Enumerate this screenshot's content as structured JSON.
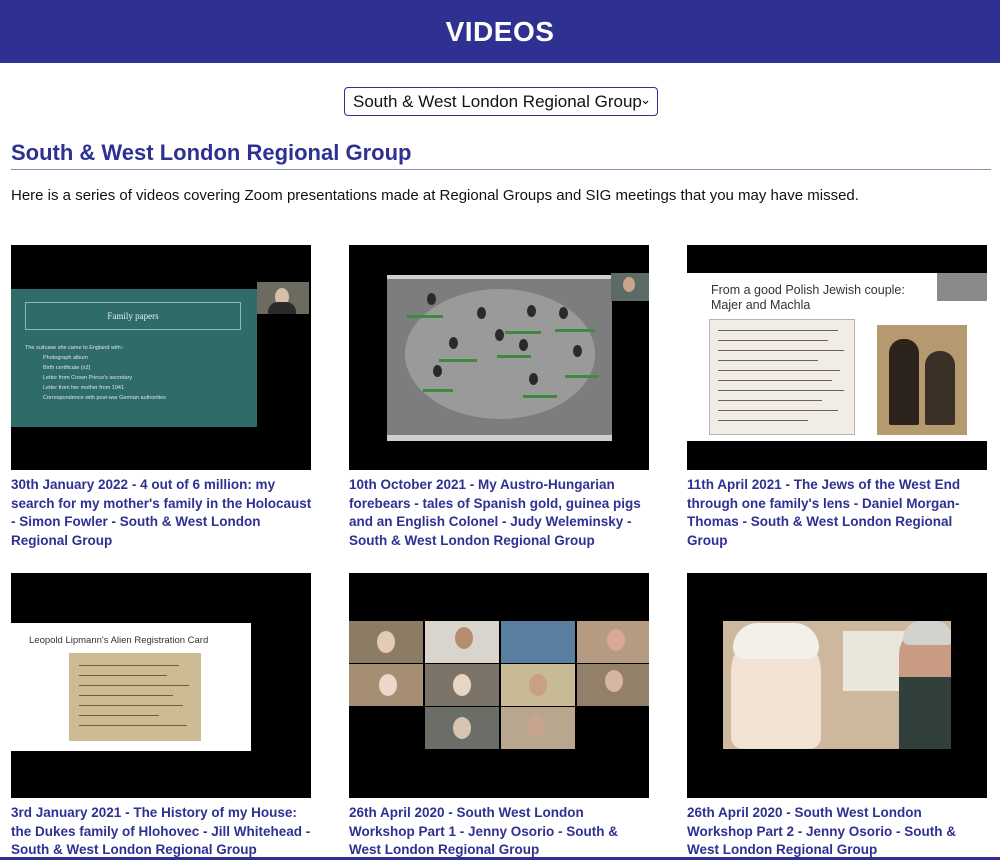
{
  "header": {
    "title": "VIDEOS"
  },
  "group_select": {
    "selected": "South & West London Regional Group"
  },
  "section": {
    "title": "South & West London Regional Group",
    "intro": "Here is a series of videos covering Zoom presentations made at Regional Groups and SIG meetings that you may have missed."
  },
  "videos": [
    {
      "caption": "30th January 2022 - 4 out of 6 million: my search for my mother's family in the Holocaust - Simon Fowler - South & West London Regional Group",
      "slide_title": "Family papers",
      "slide_lines": [
        "The suitcase she came to England with:-",
        "Photograph album",
        "Birth certificate (x2)",
        "Letter from Crown Prince's secretary",
        "Letter from her mother from 1941",
        "Correspondence with post-war German authorities"
      ]
    },
    {
      "caption": "10th October 2021 - My Austro-Hungarian forebears - tales of Spanish gold, guinea pigs and an English Colonel - Judy Weleminsky - South & West London Regional Group"
    },
    {
      "caption": "11th April 2021 - The Jews of the West End through one family's lens - Daniel Morgan-Thomas - South & West London Regional Group",
      "slide_title_line1": "From a good Polish Jewish couple:",
      "slide_title_line2": "Majer and Machla"
    },
    {
      "caption": "3rd January 2021 - The History of my House: the Dukes family of Hlohovec - Jill Whitehead - South & West London Regional Group",
      "slide_title": "Leopold Lipmann's Alien Registration Card"
    },
    {
      "caption": "26th April 2020 - South West London Workshop Part 1 - Jenny Osorio - South & West London Regional Group"
    },
    {
      "caption": "26th April 2020 - South West London Workshop Part 2 - Jenny Osorio - South & West London Regional Group"
    }
  ],
  "colors": {
    "brand": "#2e3192",
    "link": "#2e3192",
    "thumb_bg": "#000000"
  },
  "icons": {
    "select": "chevron-down-icon"
  }
}
